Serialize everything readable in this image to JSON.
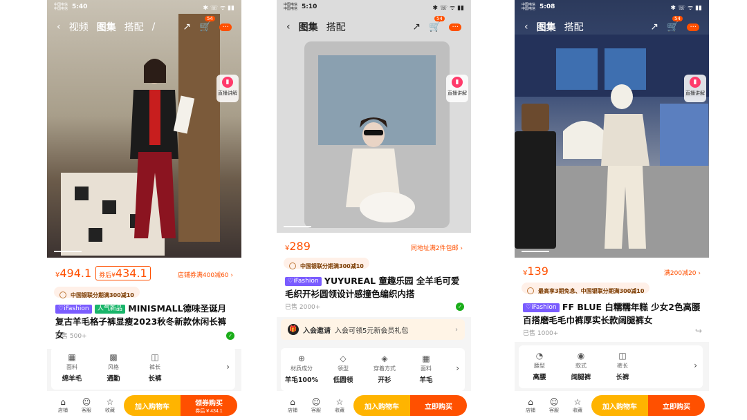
{
  "phones": [
    {
      "status": {
        "carrier1": "中国电信",
        "carrier2": "中国电信",
        "time": "5:40",
        "right": "✱ ☏ ᯤ ▮▮"
      },
      "nav": {
        "back": "‹",
        "tabs": [
          "视频",
          "图集",
          "搭配",
          "/"
        ],
        "active": 1,
        "cart_count": "54",
        "more": "···"
      },
      "live": "直播讲解",
      "price": {
        "currency": "¥",
        "value": "494.1",
        "coupon_tag": "券后¥",
        "coupon_value": "434.1",
        "promo": "店铺券满400减60 ›"
      },
      "unionpay": "中国银联分期满300减10",
      "badges": [
        {
          "text": "♡iFashion",
          "color": "purple"
        },
        {
          "text": "人气新品",
          "color": "green"
        }
      ],
      "title": "MINISMALL德味圣诞月复古羊毛格子裤显瘦2023秋冬新款休闲长裤女",
      "sold": "已售 500+",
      "attrs": [
        {
          "icon": "▦",
          "label": "面料",
          "value": "绵羊毛"
        },
        {
          "icon": "▩",
          "label": "风格",
          "value": "通勤"
        },
        {
          "icon": "◫",
          "label": "裤长",
          "value": "长裤"
        }
      ],
      "bottom": {
        "shop": "店铺",
        "service": "客服",
        "fav": "收藏",
        "cart_btn": "加入购物车",
        "buy_btn": "领券购买",
        "buy_sub": "券后 ¥ 434.1"
      }
    },
    {
      "status": {
        "carrier1": "中国电信",
        "carrier2": "中国电信",
        "time": "5:10",
        "right": "✱ ☏ ᯤ ▮▮"
      },
      "nav": {
        "back": "‹",
        "tabs": [
          "图集",
          "搭配"
        ],
        "active": 0,
        "cart_count": "54",
        "more": "···"
      },
      "live": "直播讲解",
      "price": {
        "currency": "¥",
        "value": "289",
        "promo": "同地址满2件包邮 ›"
      },
      "unionpay": "中国银联分期满300减10",
      "badges": [
        {
          "text": "♡iFashion",
          "color": "purple"
        }
      ],
      "title": "YUYUREAL 童趣乐园 全羊毛可爱毛织开衫圆领设计感撞色编织内搭",
      "sold": "已售 2000+",
      "invite": {
        "icon": "🎁",
        "bold": "入会邀请",
        "text": "入会可领5元新会员礼包",
        "arrow": "›"
      },
      "attrs": [
        {
          "icon": "⊕",
          "label": "材质成分",
          "value": "羊毛100%"
        },
        {
          "icon": "◇",
          "label": "领型",
          "value": "低圆领"
        },
        {
          "icon": "◈",
          "label": "穿着方式",
          "value": "开衫"
        },
        {
          "icon": "▦",
          "label": "面料",
          "value": "羊毛"
        }
      ],
      "bottom": {
        "shop": "店铺",
        "service": "客服",
        "fav": "收藏",
        "cart_btn": "加入购物车",
        "buy_btn": "立即购买"
      }
    },
    {
      "status": {
        "carrier1": "中国电信",
        "carrier2": "中国电信",
        "time": "5:08",
        "right": "✱ ☏ ᯤ ▮▮"
      },
      "nav": {
        "back": "‹",
        "tabs": [
          "图集",
          "搭配"
        ],
        "active": 0,
        "cart_count": "54",
        "more": "···"
      },
      "live": "直播讲解",
      "price": {
        "currency": "¥",
        "value": "139",
        "promo": "满200减20 ›"
      },
      "unionpay": "最高享3期免息、中国银联分期满300减10",
      "badges": [
        {
          "text": "♡iFashion",
          "color": "purple"
        }
      ],
      "title": "FF BLUE 白糯糯年糕 少女2色高腰百搭磨毛毛巾裤厚实长款阔腿裤女",
      "sold": "已售 1000+",
      "attrs": [
        {
          "icon": "◔",
          "label": "腰型",
          "value": "高腰"
        },
        {
          "icon": "◉",
          "label": "款式",
          "value": "阔腿裤"
        },
        {
          "icon": "◫",
          "label": "裤长",
          "value": "长裤"
        }
      ],
      "bottom": {
        "shop": "店铺",
        "service": "客服",
        "fav": "收藏",
        "cart_btn": "加入购物车",
        "buy_btn": "立即购买"
      }
    }
  ]
}
